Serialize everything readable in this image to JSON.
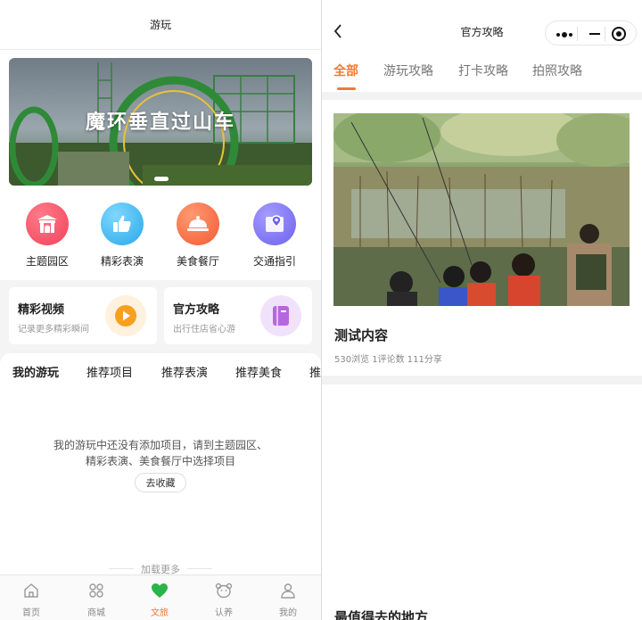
{
  "left": {
    "header_title": "游玩",
    "banner": {
      "title": "魔环垂直过山车"
    },
    "icons": [
      {
        "label": "主题园区",
        "icon": "gate-icon",
        "color": "#f0435a"
      },
      {
        "label": "精彩表演",
        "icon": "thumbs-up-icon",
        "color": "#29a8e8"
      },
      {
        "label": "美食餐厅",
        "icon": "dish-cover-icon",
        "color": "#f25a33"
      },
      {
        "label": "交通指引",
        "icon": "map-pin-icon",
        "color": "#6c62ee"
      }
    ],
    "cards": [
      {
        "title": "精彩视频",
        "subtitle": "记录更多精彩瞬间",
        "icon": "play-icon",
        "color": "#f7a01e"
      },
      {
        "title": "官方攻略",
        "subtitle": "出行住店省心游",
        "icon": "book-icon",
        "color": "#b766e0"
      }
    ],
    "tabs": [
      "我的游玩",
      "推荐项目",
      "推荐表演",
      "推荐美食",
      "推"
    ],
    "empty_line1": "我的游玩中还没有添加项目，请到主题园区、",
    "empty_line2": "精彩表演、美食餐厅中选择项目",
    "collect_button": "去收藏",
    "load_more": "加载更多",
    "tabbar": [
      {
        "label": "首页",
        "icon": "home-icon",
        "active": false
      },
      {
        "label": "商城",
        "icon": "grid-icon",
        "active": false
      },
      {
        "label": "文旅",
        "icon": "heart-icon",
        "active": true
      },
      {
        "label": "认养",
        "icon": "bear-icon",
        "active": false
      },
      {
        "label": "我的",
        "icon": "person-icon",
        "active": false
      }
    ]
  },
  "right": {
    "header_title": "官方攻略",
    "tabs": [
      "全部",
      "游玩攻略",
      "打卡攻略",
      "拍照攻略"
    ],
    "active_tab": "全部",
    "article": {
      "title": "测试内容",
      "stats": "530浏览 1评论数 111分享"
    },
    "section_title": "最值得去的地方"
  },
  "colors": {
    "accent": "#f07a35",
    "active_green": "#2bb44a"
  }
}
